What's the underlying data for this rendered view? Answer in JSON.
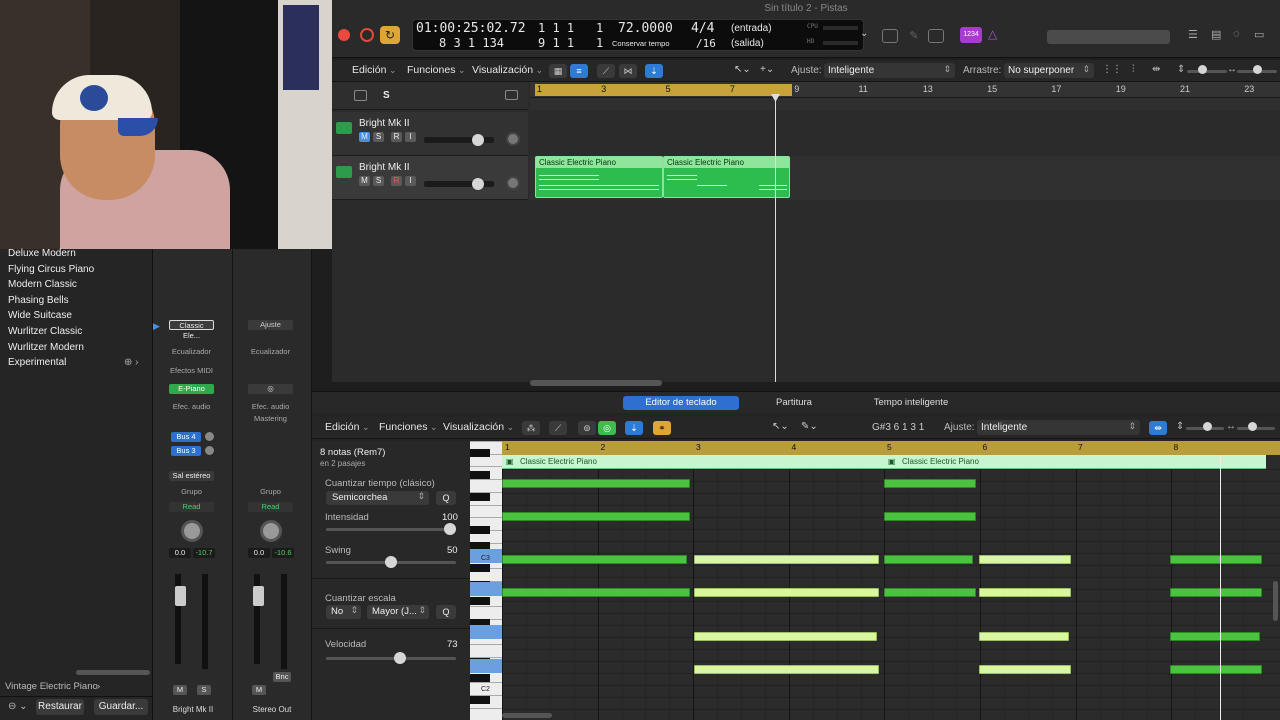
{
  "window_title": "Sin título 2 - Pistas",
  "lcd": {
    "time": "01:00:25:02.72",
    "bars_top": "1  1  1",
    "bars_top_last": "1",
    "bars_bottom": "8  3  1  134",
    "bars_bottom2": "9  1  1",
    "bars_bottom2_last": "1",
    "tempo": "72.0000",
    "tempo_label": "Conservar tempo",
    "time_sig": "4/4",
    "division": "/16",
    "in_label": "(entrada)",
    "out_label": "(salida)",
    "cpu": "CPU",
    "hd": "HD"
  },
  "count_badge": "1234",
  "main_toolbar": {
    "edit": "Edición",
    "functions": "Funciones",
    "view": "Visualización",
    "snap_label": "Ajuste:",
    "snap_value": "Inteligente",
    "drag_label": "Arrastre:",
    "drag_value": "No superponer"
  },
  "track_header_buttons": {
    "s": "S"
  },
  "ruler_main": [
    "1",
    "3",
    "5",
    "7",
    "9",
    "11",
    "13",
    "15",
    "17",
    "19",
    "21",
    "23"
  ],
  "tracks": [
    {
      "name": "Bright Mk II",
      "m": "M",
      "s": "S",
      "r": "R",
      "i": "I"
    },
    {
      "name": "Bright Mk II",
      "m": "M",
      "s": "S",
      "r": "R",
      "i": "I"
    }
  ],
  "regions": [
    {
      "title": "Classic Electric Piano"
    },
    {
      "title": "Classic Electric Piano"
    }
  ],
  "library": {
    "items": [
      "Deluxe Modern",
      "Flying Circus Piano",
      "Modern Classic",
      "Phasing Bells",
      "Wide Suitcase",
      "Wurlitzer Classic",
      "Wurlitzer Modern",
      "Experimental"
    ],
    "footer_path": "Vintage Electric Piano",
    "restore": "Restaurar",
    "save": "Guardar..."
  },
  "mixer": {
    "strip1": {
      "plugin": "Classic Ele...",
      "eq": "Ecualizador",
      "midi_fx": "Efectos MIDI",
      "instrument": "E-Piano",
      "audio_fx": "Efec. audio",
      "bus1": "Bus 4",
      "bus2": "Bus 3",
      "output": "Sal estéreo",
      "group": "Grupo",
      "automation": "Read",
      "pan_val": "0.0",
      "level": "-10.7",
      "m": "M",
      "s": "S",
      "name": "Bright Mk II"
    },
    "strip2": {
      "plugin": "Ajuste",
      "eq": "Ecualizador",
      "audio_fx": "Efec. audio",
      "fx_slot": "Mastering",
      "group": "Grupo",
      "automation": "Read",
      "pan_val": "0.0",
      "level": "-10.6",
      "m": "M",
      "bnc": "Bnc",
      "name": "Stereo Out"
    }
  },
  "editor": {
    "tabs": [
      "Editor de teclado",
      "Partitura",
      "Tempo inteligente"
    ],
    "edit": "Edición",
    "functions": "Funciones",
    "view": "Visualización",
    "position": "G#3   6 1 3 1",
    "snap_label": "Ajuste:",
    "snap_value": "Inteligente",
    "note_count": "8 notas (Rem7)",
    "passages": "en 2 pasajes",
    "quantize_label": "Cuantizar tiempo (clásico)",
    "quantize_value": "Semicorchea",
    "q": "Q",
    "intensity_label": "Intensidad",
    "intensity_value": "100",
    "swing_label": "Swing",
    "swing_value": "50",
    "scale_label": "Cuantizar escala",
    "scale_no": "No",
    "scale_mode": "Mayor (J...",
    "velocity_label": "Velocidad",
    "velocity_value": "73",
    "key_c3": "C3",
    "key_c2": "C2",
    "region_title_1": "Classic Electric Piano",
    "region_title_2": "Classic Electric Piano",
    "ruler": [
      "1",
      "2",
      "3",
      "4",
      "5",
      "6",
      "7",
      "8"
    ]
  },
  "colors": {
    "region_green": "#2dbd4e",
    "note_selected": "#d8f7a0",
    "note_default": "#4cc340",
    "accent_blue": "#2e6fcf",
    "ruler_gold": "#b89d3a"
  }
}
